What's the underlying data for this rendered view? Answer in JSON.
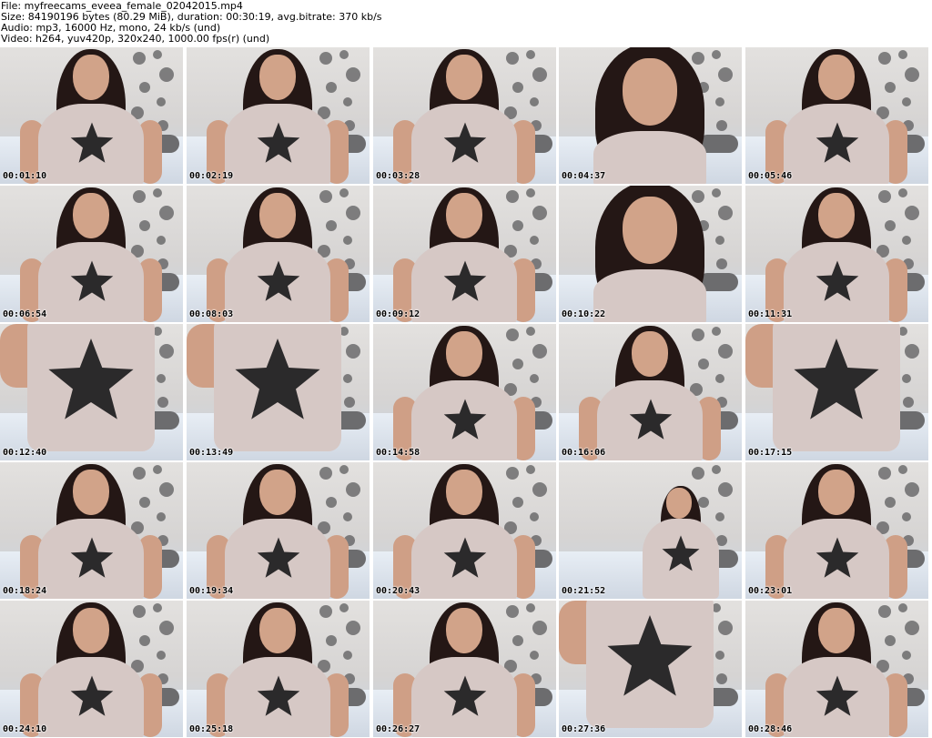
{
  "header": {
    "file_line": "File: myfreecams_eveea_female_02042015.mp4",
    "size_line": "Size: 84190196 bytes (80.29 MiB), duration: 00:30:19, avg.bitrate: 370 kb/s",
    "audio_line": "Audio: mp3, 16000 Hz, mono, 24 kb/s (und)",
    "video_line": "Video: h264, yuv420p, 320x240, 1000.00 fps(r) (und)"
  },
  "thumbnails": [
    {
      "time": "00:01:10",
      "pose": "mid"
    },
    {
      "time": "00:02:19",
      "pose": "mid"
    },
    {
      "time": "00:03:28",
      "pose": "mid"
    },
    {
      "time": "00:04:37",
      "pose": "close"
    },
    {
      "time": "00:05:46",
      "pose": "mid"
    },
    {
      "time": "00:06:54",
      "pose": "mid"
    },
    {
      "time": "00:08:03",
      "pose": "mid"
    },
    {
      "time": "00:09:12",
      "pose": "mid"
    },
    {
      "time": "00:10:22",
      "pose": "close"
    },
    {
      "time": "00:11:31",
      "pose": "mid"
    },
    {
      "time": "00:12:40",
      "pose": "torso"
    },
    {
      "time": "00:13:49",
      "pose": "torso"
    },
    {
      "time": "00:14:58",
      "pose": "mid"
    },
    {
      "time": "00:16:06",
      "pose": "mid"
    },
    {
      "time": "00:17:15",
      "pose": "torso"
    },
    {
      "time": "00:18:24",
      "pose": "mid"
    },
    {
      "time": "00:19:34",
      "pose": "mid"
    },
    {
      "time": "00:20:43",
      "pose": "mid"
    },
    {
      "time": "00:21:52",
      "pose": "far"
    },
    {
      "time": "00:23:01",
      "pose": "mid"
    },
    {
      "time": "00:24:10",
      "pose": "mid"
    },
    {
      "time": "00:25:18",
      "pose": "mid"
    },
    {
      "time": "00:26:27",
      "pose": "mid"
    },
    {
      "time": "00:27:36",
      "pose": "torso"
    },
    {
      "time": "00:28:46",
      "pose": "mid"
    }
  ],
  "colors": {
    "background": "#ffffff",
    "hair": "#241715",
    "skin": "#d1a389",
    "shirt": "#d6c8c5",
    "star": "#2b2a2b",
    "pillow": "#6c6c6e"
  }
}
